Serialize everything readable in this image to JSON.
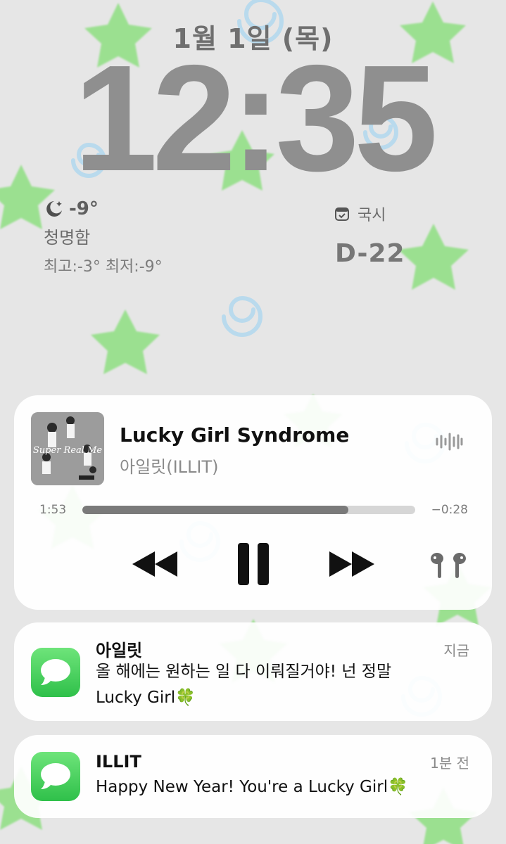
{
  "lockscreen": {
    "date": "1월 1일 (목)",
    "time": "12:35"
  },
  "weather": {
    "icon": "moon-stars-icon",
    "temperature": "-9°",
    "condition": "청명함",
    "high_low": "최고:-3° 최저:-9°"
  },
  "countdown": {
    "icon": "calendar-check-icon",
    "label": "국시",
    "value": "D-22"
  },
  "now_playing": {
    "title": "Lucky Girl Syndrome",
    "artist": "아일릿(ILLIT)",
    "elapsed": "1:53",
    "remaining": "−0:28",
    "progress_fraction": 0.8,
    "album_text": "Super Real Me",
    "controls": [
      "rewind-icon",
      "pause-icon",
      "fast-forward-icon",
      "airpods-icon"
    ]
  },
  "notifications": [
    {
      "app_icon": "messages-icon",
      "sender": "아일릿",
      "time": "지금",
      "body_line1": "올 해에는 원하는 일 다 이뤄질거야! 넌 정말",
      "body_line2": "Lucky Girl🍀"
    },
    {
      "app_icon": "messages-icon",
      "sender": "ILLIT",
      "time": "1분 전",
      "body_line1": "Happy New Year! You're a Lucky Girl🍀"
    }
  ],
  "colors": {
    "background": "#e6e6e6",
    "star_green": "#8be07f",
    "swirl_blue": "#a9d6ef",
    "messages_green": "#34c759"
  }
}
